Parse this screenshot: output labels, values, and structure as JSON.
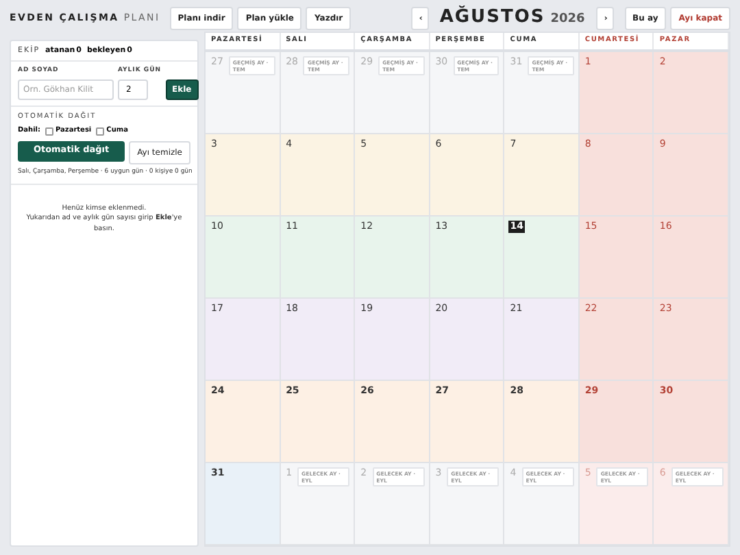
{
  "header": {
    "title": "EVDEN ÇALIŞMA",
    "title_suffix": "PLANI",
    "buttons": [
      "Planı indir",
      "Plan yükle",
      "Yazdır"
    ],
    "prev": "‹",
    "month": "AĞUSTOS",
    "year": "2026",
    "next": "›",
    "today_button": "Bu ay",
    "close_button": "Ayı kapat"
  },
  "panel": {
    "team_label": "EKİP",
    "assigned_label": "atanan",
    "assigned": "0",
    "waiting_label": "bekleyen",
    "waiting": "0",
    "name_label": "AD SOYAD",
    "name_placeholder": "Örn. Gökhan Kilit",
    "days_label": "AYLIK GÜN",
    "days_value": "2",
    "add_button": "Ekle",
    "auto_label": "OTOMATİK DAĞIT",
    "include_label": "Dahil:",
    "include": [
      {
        "label": "Pazartesi",
        "checked": false
      },
      {
        "label": "Cuma",
        "checked": false
      }
    ],
    "distribute_button": "Otomatik dağıt",
    "clear_button": "Ayı temizle",
    "summary": "Salı, Çarşamba, Perşembe · 6 uygun gün · 0 kişiye 0 gün",
    "empty_lines": [
      "Henüz kimse eklenmedi.",
      "Yukarıdan ad ve aylık gün sayısı girip **Ekle**'ye basın."
    ]
  },
  "calendar": {
    "weekdays": [
      {
        "label": "PAZARTESİ",
        "weekend": false
      },
      {
        "label": "SALI",
        "weekend": false
      },
      {
        "label": "ÇARŞAMBA",
        "weekend": false
      },
      {
        "label": "PERŞEMBE",
        "weekend": false
      },
      {
        "label": "CUMA",
        "weekend": false
      },
      {
        "label": "CUMARTESİ",
        "weekend": true
      },
      {
        "label": "PAZAR",
        "weekend": true
      }
    ],
    "weeks": [
      {
        "days": [
          {
            "day": "27",
            "other_month": true,
            "tag": "GEÇMİŞ AY · TEM"
          },
          {
            "day": "28",
            "other_month": true,
            "tag": "GEÇMİŞ AY · TEM"
          },
          {
            "day": "29",
            "other_month": true,
            "tag": "GEÇMİŞ AY · TEM"
          },
          {
            "day": "30",
            "other_month": true,
            "tag": "GEÇMİŞ AY · TEM"
          },
          {
            "day": "31",
            "other_month": true,
            "tag": "GEÇMİŞ AY · TEM"
          },
          {
            "day": "1",
            "other_month": false
          },
          {
            "day": "2",
            "other_month": false
          }
        ]
      },
      {
        "color": "#fbf3e3",
        "days": [
          {
            "day": "3",
            "other_month": false
          },
          {
            "day": "4",
            "other_month": false
          },
          {
            "day": "5",
            "other_month": false
          },
          {
            "day": "6",
            "other_month": false
          },
          {
            "day": "7",
            "other_month": false
          },
          {
            "day": "8",
            "other_month": false
          },
          {
            "day": "9",
            "other_month": false
          }
        ]
      },
      {
        "color": "#e8f4ec",
        "days": [
          {
            "day": "10",
            "other_month": false
          },
          {
            "day": "11",
            "other_month": false
          },
          {
            "day": "12",
            "other_month": false
          },
          {
            "day": "13",
            "other_month": false
          },
          {
            "day": "14",
            "other_month": false,
            "today": true
          },
          {
            "day": "15",
            "other_month": false
          },
          {
            "day": "16",
            "other_month": false
          }
        ]
      },
      {
        "color": "#f1ecf7",
        "days": [
          {
            "day": "17",
            "other_month": false
          },
          {
            "day": "18",
            "other_month": false
          },
          {
            "day": "19",
            "other_month": false
          },
          {
            "day": "20",
            "other_month": false
          },
          {
            "day": "21",
            "other_month": false
          },
          {
            "day": "22",
            "other_month": false
          },
          {
            "day": "23",
            "other_month": false
          }
        ]
      },
      {
        "color": "#fdf0e4",
        "days": [
          {
            "day": "24",
            "other_month": false
          },
          {
            "day": "25",
            "other_month": false
          },
          {
            "day": "26",
            "other_month": false
          },
          {
            "day": "27",
            "other_month": false
          },
          {
            "day": "28",
            "other_month": false
          },
          {
            "day": "29",
            "other_month": false
          },
          {
            "day": "30",
            "other_month": false
          }
        ]
      },
      {
        "color": "#e9f1f8",
        "days": [
          {
            "day": "31",
            "other_month": false
          },
          {
            "day": "1",
            "other_month": true,
            "tag": "GELECEK AY · EYL"
          },
          {
            "day": "2",
            "other_month": true,
            "tag": "GELECEK AY · EYL"
          },
          {
            "day": "3",
            "other_month": true,
            "tag": "GELECEK AY · EYL"
          },
          {
            "day": "4",
            "other_month": true,
            "tag": "GELECEK AY · EYL"
          },
          {
            "day": "5",
            "other_month": true,
            "tag": "GELECEK AY · EYL"
          },
          {
            "day": "6",
            "other_month": true,
            "tag": "GELECEK AY · EYL"
          }
        ]
      }
    ]
  }
}
